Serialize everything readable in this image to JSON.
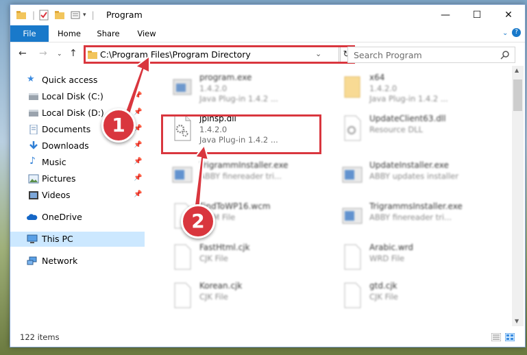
{
  "window": {
    "title": "Program",
    "controls": {
      "minimize": "—",
      "maximize": "☐",
      "close": "✕"
    }
  },
  "ribbon": {
    "tabs": [
      "File",
      "Home",
      "Share",
      "View"
    ]
  },
  "address": {
    "path": "C:\\Program Files\\Program Directory",
    "search_placeholder": "Search Program"
  },
  "sidebar": {
    "items": [
      {
        "label": "Quick access",
        "icon": "star-icon"
      },
      {
        "label": "Local Disk (C:)",
        "icon": "drive-icon",
        "pinned": true
      },
      {
        "label": "Local Disk (D:)",
        "icon": "drive-icon",
        "pinned": true
      },
      {
        "label": "Documents",
        "icon": "documents-icon",
        "pinned": true
      },
      {
        "label": "Downloads",
        "icon": "download-icon",
        "pinned": true
      },
      {
        "label": "Music",
        "icon": "music-icon",
        "pinned": true
      },
      {
        "label": "Pictures",
        "icon": "pictures-icon",
        "pinned": true
      },
      {
        "label": "Videos",
        "icon": "videos-icon",
        "pinned": true
      },
      {
        "label": "OneDrive",
        "icon": "cloud-icon"
      },
      {
        "label": "This PC",
        "icon": "computer-icon",
        "selected": true
      },
      {
        "label": "Network",
        "icon": "network-icon"
      }
    ]
  },
  "files": [
    {
      "name": "program.exe",
      "line2": "1.4.2.0",
      "line3": "Java Plug-in 1.4.2 ..."
    },
    {
      "name": "x64",
      "line2": "1.4.2.0",
      "line3": "Java Plug-in 1.4.2 ..."
    },
    {
      "name": "jpinsp.dll",
      "line2": "1.4.2.0",
      "line3": "Java Plug-in 1.4.2 ..."
    },
    {
      "name": "UpdateClient63.dll",
      "line2": "Resource DLL",
      "line3": ""
    },
    {
      "name": "TrigrammInstaller.exe",
      "line2": "ABBY finereader tri...",
      "line3": ""
    },
    {
      "name": "UpdateInstaller.exe",
      "line2": "ABBY updates installer",
      "line3": ""
    },
    {
      "name": "FindToWP16.wcm",
      "line2": "WCM File",
      "line3": ""
    },
    {
      "name": "TrigrammsInstaller.exe",
      "line2": "ABBY finereader tri...",
      "line3": ""
    },
    {
      "name": "FastHtml.cjk",
      "line2": "CJK File",
      "line3": ""
    },
    {
      "name": "Arabic.wrd",
      "line2": "WRD File",
      "line3": ""
    },
    {
      "name": "Korean.cjk",
      "line2": "CJK File",
      "line3": ""
    },
    {
      "name": "gtd.cjk",
      "line2": "CJK File",
      "line3": ""
    }
  ],
  "status": {
    "items_count": "122 items"
  },
  "annotations": {
    "step1": "1",
    "step2": "2",
    "accent": "#d9363e"
  }
}
